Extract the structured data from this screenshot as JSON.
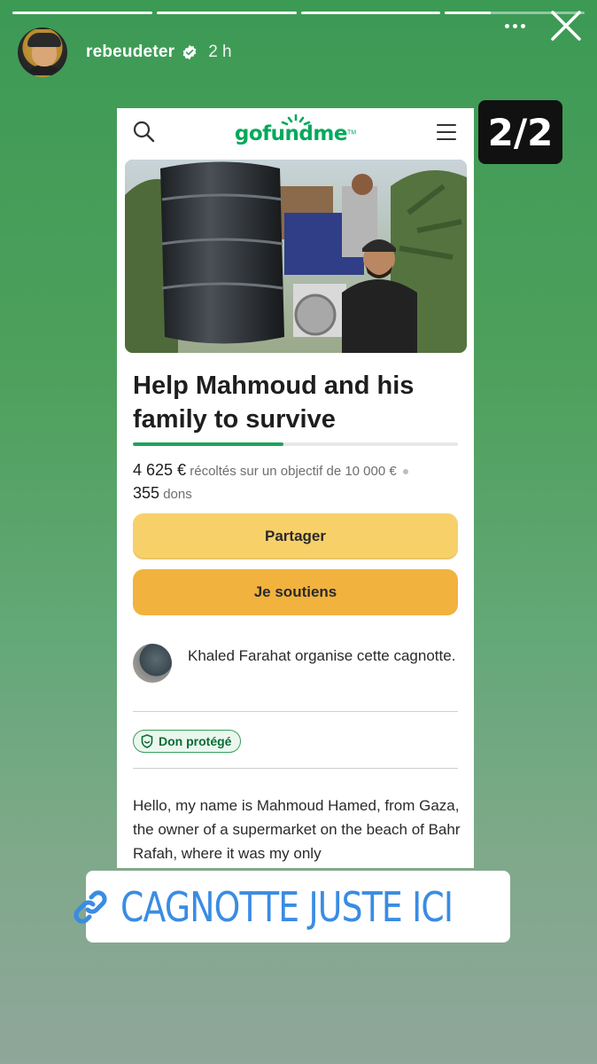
{
  "story": {
    "segments": [
      1,
      1,
      1,
      0.33
    ],
    "username": "rebeudeter",
    "time": "2 h",
    "counter": "2/2",
    "link_label": "CAGNOTTE JUSTE ICI"
  },
  "gofundme": {
    "logo": "gofundme",
    "logo_tm": "TM",
    "title": "Help Mahmoud and his family to survive",
    "raised_amount": "4 625 €",
    "raised_text": "récoltés sur un objectif de 10 000 €",
    "donations_count": "355",
    "donations_label": "dons",
    "progress": 0.4625,
    "share_label": "Partager",
    "donate_label": "Je soutiens",
    "organizer_text": "Khaled Farahat organise cette cagnotte.",
    "badge_label": "Don protégé",
    "story_text": "Hello, my name is Mahmoud Hamed, from Gaza, the owner of a supermarket on the beach of Bahr Rafah, where it was my only"
  },
  "colors": {
    "brand_green": "#02a95c",
    "share_yellow": "#f7d06a",
    "donate_orange": "#f2b23e",
    "link_blue": "#3a8ce3"
  },
  "icons": [
    "verified-icon",
    "more-icon",
    "close-icon",
    "search-icon",
    "menu-icon",
    "shield-icon",
    "link-icon"
  ]
}
